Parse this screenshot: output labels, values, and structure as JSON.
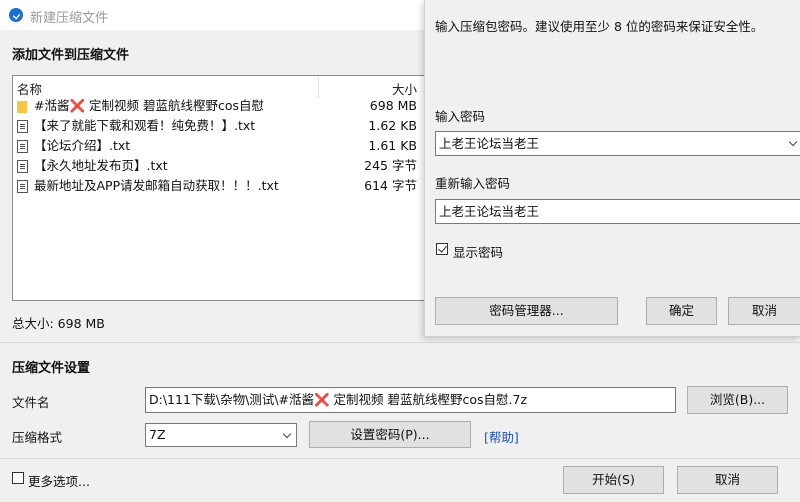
{
  "window": {
    "title": "新建压缩文件"
  },
  "add_files": {
    "heading": "添加文件到压缩文件",
    "columns": {
      "name": "名称",
      "size": "大小"
    },
    "files": [
      {
        "icon": "folder-icon",
        "name": "#湉酱❌ 定制视频  碧蓝航线樫野cos自慰",
        "size": "698 MB"
      },
      {
        "icon": "text-file-icon",
        "name": "【来了就能下载和观看！纯免费！】.txt",
        "size": "1.62 KB"
      },
      {
        "icon": "text-file-icon",
        "name": "【论坛介绍】.txt",
        "size": "1.61 KB"
      },
      {
        "icon": "text-file-icon",
        "name": "【永久地址发布页】.txt",
        "size": "245 字节"
      },
      {
        "icon": "text-file-icon",
        "name": "最新地址及APP请发邮箱自动获取！！！.txt",
        "size": "614 字节"
      }
    ],
    "total_size": "总大小: 698 MB"
  },
  "settings": {
    "heading": "压缩文件设置",
    "filename_label": "文件名",
    "filename_value": "D:\\111下载\\杂物\\测试\\#湉酱❌ 定制视频  碧蓝航线樫野cos自慰.7z",
    "browse_button": "浏览(B)...",
    "format_label": "压缩格式",
    "format_value": "7Z",
    "set_password_button": "设置密码(P)...",
    "help_link": "[帮助]"
  },
  "footer": {
    "more_options": "更多选项...",
    "more_options_checked": false,
    "start_button": "开始(S)",
    "cancel_button": "取消"
  },
  "password_dialog": {
    "hint": "输入压缩包密码。建议使用至少 8 位的密码来保证安全性。",
    "password_label": "输入密码",
    "password_value": "上老王论坛当老王",
    "confirm_label": "重新输入密码",
    "confirm_value": "上老王论坛当老王",
    "show_password": "显示密码",
    "show_password_checked": true,
    "manager_button": "密码管理器...",
    "ok_button": "确定",
    "cancel_button": "取消"
  },
  "colors": {
    "link": "#1a4fb8",
    "folder": "#f5c542",
    "app_icon": "#1a6fd6"
  }
}
